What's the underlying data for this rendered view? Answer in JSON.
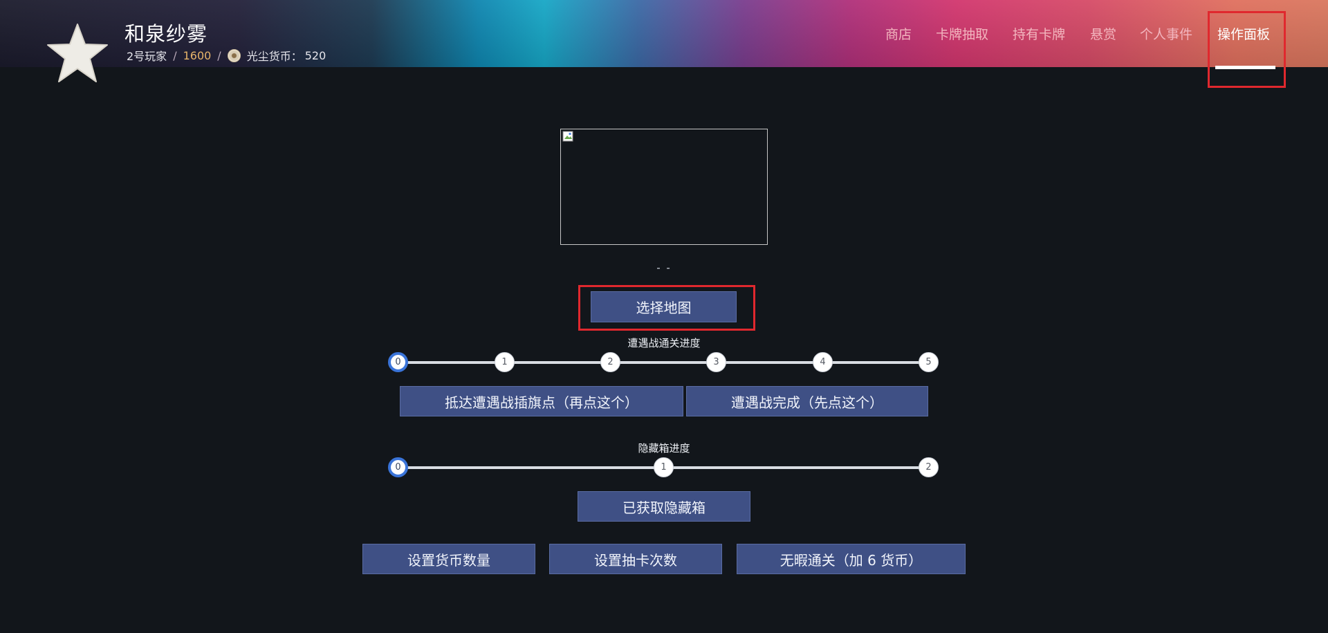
{
  "header": {
    "player_name": "和泉纱雾",
    "player_rank": "2号玩家",
    "separator": "/",
    "score": "1600",
    "currency_label": "光尘货币：",
    "currency_value": "520",
    "nav": [
      {
        "label": "商店",
        "active": false
      },
      {
        "label": "卡牌抽取",
        "active": false
      },
      {
        "label": "持有卡牌",
        "active": false
      },
      {
        "label": "悬赏",
        "active": false
      },
      {
        "label": "个人事件",
        "active": false
      },
      {
        "label": "操作面板",
        "active": true
      }
    ]
  },
  "main": {
    "map_name": "- -",
    "select_map_button": "选择地图",
    "encounter": {
      "label": "遭遇战通关进度",
      "steps": [
        "0",
        "1",
        "2",
        "3",
        "4",
        "5"
      ],
      "current": 0,
      "arrive_button": "抵达遭遇战插旗点（再点这个）",
      "complete_button": "遭遇战完成（先点这个）"
    },
    "hidden_box": {
      "label": "隐藏箱进度",
      "steps": [
        "0",
        "1",
        "2"
      ],
      "current": 0,
      "obtained_button": "已获取隐藏箱"
    },
    "bottom_buttons": {
      "set_currency": "设置货币数量",
      "set_draws": "设置抽卡次数",
      "flawless": "无暇通关（加 6 货币）"
    }
  },
  "colors": {
    "background": "#12161b",
    "button": "#3f5085",
    "highlight": "#e0282e",
    "node_active_ring": "#3a74d9",
    "score": "#e8b56a"
  },
  "icons": {
    "avatar": "star-avatar",
    "coin": "coin-icon",
    "map_image": "broken-image-icon"
  }
}
